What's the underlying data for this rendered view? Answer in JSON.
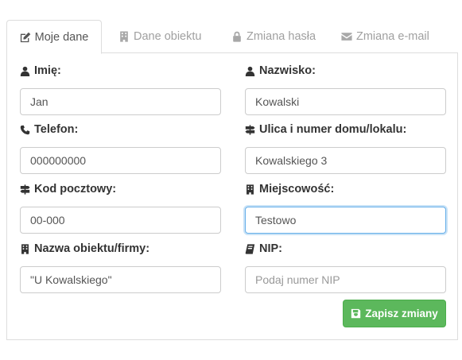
{
  "tabs": [
    {
      "label": "Moje dane",
      "icon": "edit-icon",
      "active": true
    },
    {
      "label": "Dane obiektu",
      "icon": "building-icon",
      "active": false
    },
    {
      "label": "Zmiana hasła",
      "icon": "lock-icon",
      "active": false
    },
    {
      "label": "Zmiana e-mail",
      "icon": "envelope-icon",
      "active": false
    }
  ],
  "form": {
    "first_name": {
      "label": "Imię:",
      "icon": "user-icon",
      "value": "Jan"
    },
    "last_name": {
      "label": "Nazwisko:",
      "icon": "user-icon",
      "value": "Kowalski"
    },
    "phone": {
      "label": "Telefon:",
      "icon": "phone-icon",
      "value": "000000000"
    },
    "street": {
      "label": "Ulica i numer domu/lokalu:",
      "icon": "signpost-icon",
      "value": "Kowalskiego 3"
    },
    "postal_code": {
      "label": "Kod pocztowy:",
      "icon": "signpost-icon",
      "value": "00-000"
    },
    "city": {
      "label": "Miejscowość:",
      "icon": "building-icon",
      "value": "Testowo"
    },
    "company": {
      "label": "Nazwa obiektu/firmy:",
      "icon": "building-icon",
      "value": "\"U Kowalskiego\""
    },
    "nip": {
      "label": "NIP:",
      "icon": "book-icon",
      "value": "",
      "placeholder": "Podaj numer NIP"
    }
  },
  "save_button": {
    "label": "Zapisz zmiany",
    "icon": "save-icon",
    "color": "#5cb85c"
  },
  "colors": {
    "focus": "#66afe9",
    "border": "#dddddd",
    "tab_inactive": "#a0a0a0"
  }
}
